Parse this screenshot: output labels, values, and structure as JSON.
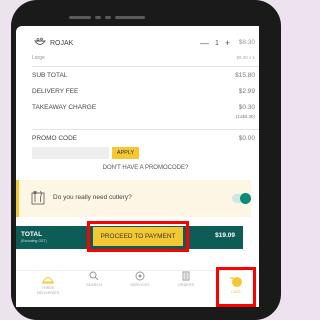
{
  "cart_item": {
    "name": "ROJAK",
    "size": "Large",
    "qty_minus": "—",
    "qty": "1",
    "qty_plus": "+",
    "price": "$8.30",
    "price_each": "$8.30 x 1"
  },
  "summary": {
    "subtotal_label": "SUB TOTAL",
    "subtotal_value": "$15.80",
    "delivery_label": "DELIVERY FEE",
    "delivery_value": "$2.99",
    "takeaway_label": "TAKEAWAY CHARGE",
    "takeaway_value": "$0.30",
    "takeaway_sub": "(1x$0.30)"
  },
  "promo": {
    "label": "PROMO CODE",
    "value": "$0.00",
    "input_placeholder": "",
    "apply_label": "APPLY",
    "no_code_link": "DON'T HAVE A PROMOCODE?"
  },
  "cutlery": {
    "question": "Do you really need cutlery?",
    "enabled": true
  },
  "total": {
    "label": "TOTAL",
    "sub": "(Excluding GST)",
    "value": "$19.09"
  },
  "proceed_label": "PROCEED TO PAYMENT",
  "tabs": [
    {
      "label": "THREE DELIVERIES",
      "icon": "food-dome-icon"
    },
    {
      "label": "SEARCH",
      "icon": "search-icon"
    },
    {
      "label": "SERVICES",
      "icon": "services-icon"
    },
    {
      "label": "ORDERS",
      "icon": "orders-icon"
    },
    {
      "label": "CART",
      "icon": "cart-icon",
      "active": true
    }
  ],
  "colors": {
    "accent": "#f4c832",
    "total_bar": "#0d5c56",
    "highlight": "#ff0000"
  }
}
